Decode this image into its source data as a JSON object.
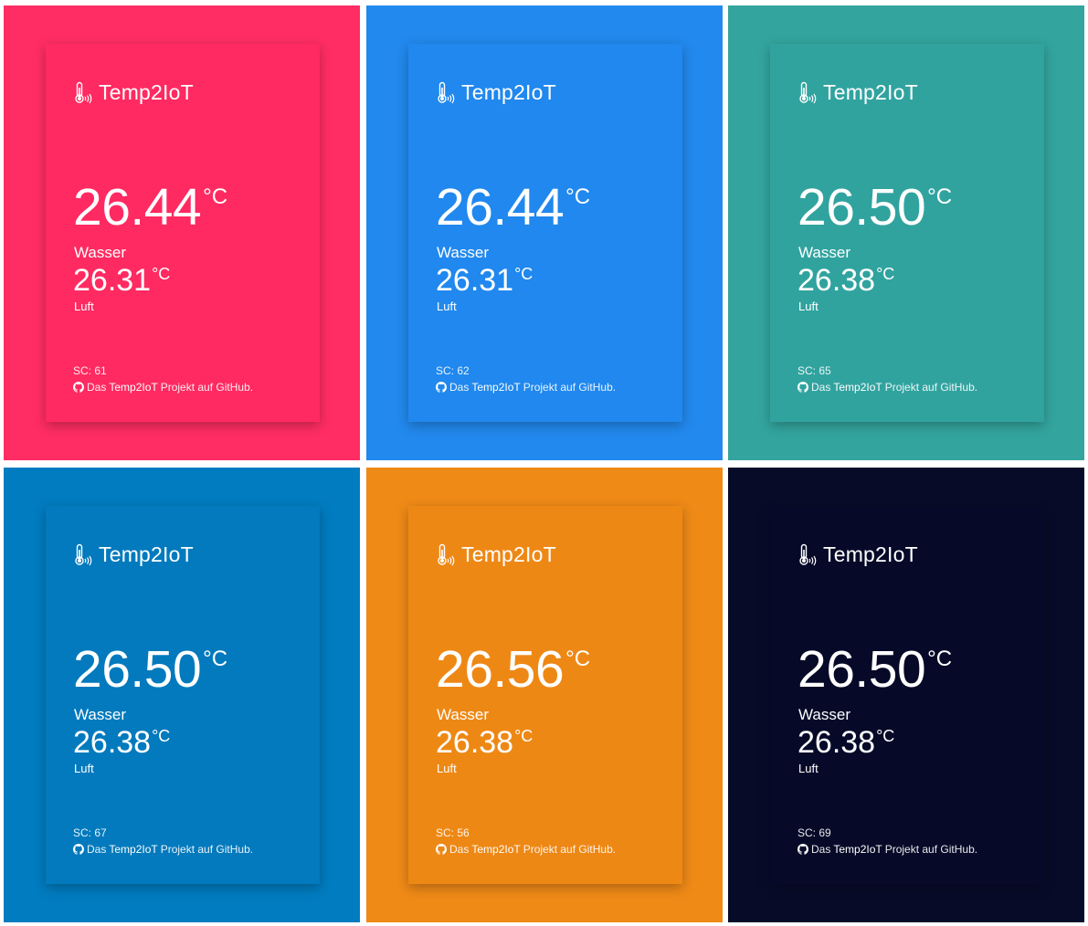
{
  "panels": [
    {
      "bg": "#ff2d63",
      "card": "#ff2a61",
      "brand": "Temp2IoT",
      "water_value": "26.44",
      "water_unit": "°C",
      "water_label": "Wasser",
      "air_value": "26.31",
      "air_unit": "°C",
      "air_label": "Luft",
      "sc": "SC: 61",
      "footer_pre": "Das",
      "footer_link": "Temp2IoT",
      "footer_post": "Projekt auf GitHub."
    },
    {
      "bg": "#2289ee",
      "card": "#2088ee",
      "brand": "Temp2IoT",
      "water_value": "26.44",
      "water_unit": "°C",
      "water_label": "Wasser",
      "air_value": "26.31",
      "air_unit": "°C",
      "air_label": "Luft",
      "sc": "SC: 62",
      "footer_pre": "Das",
      "footer_link": "Temp2IoT",
      "footer_post": "Projekt auf GitHub."
    },
    {
      "bg": "#33a59e",
      "card": "#31a39f",
      "brand": "Temp2IoT",
      "water_value": "26.50",
      "water_unit": "°C",
      "water_label": "Wasser",
      "air_value": "26.38",
      "air_unit": "°C",
      "air_label": "Luft",
      "sc": "SC: 65",
      "footer_pre": "Das",
      "footer_link": "Temp2IoT",
      "footer_post": "Projekt auf GitHub."
    },
    {
      "bg": "#017cc0",
      "card": "#027abd",
      "brand": "Temp2IoT",
      "water_value": "26.50",
      "water_unit": "°C",
      "water_label": "Wasser",
      "air_value": "26.38",
      "air_unit": "°C",
      "air_label": "Luft",
      "sc": "SC: 67",
      "footer_pre": "Das",
      "footer_link": "Temp2IoT",
      "footer_post": "Projekt auf GitHub."
    },
    {
      "bg": "#ef8a17",
      "card": "#ee8815",
      "brand": "Temp2IoT",
      "water_value": "26.56",
      "water_unit": "°C",
      "water_label": "Wasser",
      "air_value": "26.38",
      "air_unit": "°C",
      "air_label": "Luft",
      "sc": "SC: 56",
      "footer_pre": "Das",
      "footer_link": "Temp2IoT",
      "footer_post": "Projekt auf GitHub."
    },
    {
      "bg": "#070b28",
      "card": "#060a28",
      "brand": "Temp2IoT",
      "water_value": "26.50",
      "water_unit": "°C",
      "water_label": "Wasser",
      "air_value": "26.38",
      "air_unit": "°C",
      "air_label": "Luft",
      "sc": "SC: 69",
      "footer_pre": "Das",
      "footer_link": "Temp2IoT",
      "footer_post": "Projekt auf GitHub."
    }
  ]
}
